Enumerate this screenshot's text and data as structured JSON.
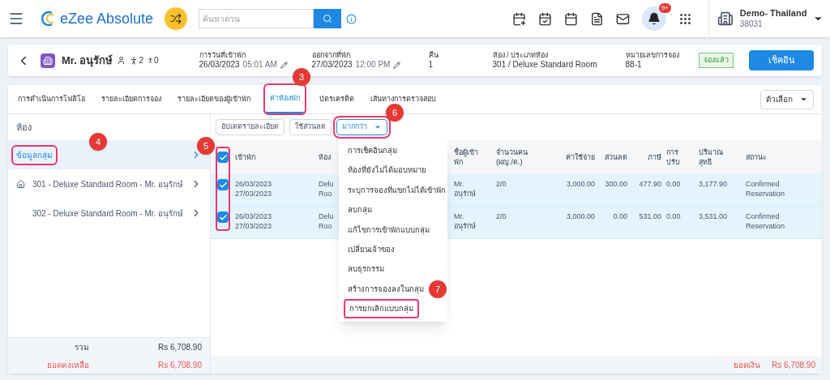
{
  "top_bar": {
    "brand": "eZee Absolute",
    "search": {
      "placeholder": "ค้นหาด่วน"
    },
    "notification_count": "9+",
    "property": {
      "name": "Demo- Thailand",
      "code": "38031"
    }
  },
  "booking_header": {
    "guest": "Mr. อนุรักษ์",
    "adults": "2",
    "children": "0",
    "fields": [
      {
        "label": "การวันที่เข้าพัก",
        "value": "26/03/2023",
        "time": "05:01 AM",
        "editable": true
      },
      {
        "label": "ออกจากที่พัก",
        "value": "27/03/2023",
        "time": "12:00 PM",
        "editable": true
      },
      {
        "label": "คืน",
        "value": "1",
        "editable": false
      },
      {
        "label": "ห้อง / ประเภทห้อง",
        "value": "301 / Deluxe Standard Room",
        "editable": false
      },
      {
        "label": "หมายเลขการจอง",
        "value": "88-1",
        "editable": false
      }
    ],
    "status": "จองแล้ว",
    "action": "เช็คอิน"
  },
  "tabs": [
    {
      "label": "การดำเนินการโฟลิโอ",
      "selected": false,
      "highlighted": false
    },
    {
      "label": "รายละเอียดการจอง",
      "selected": false,
      "highlighted": false
    },
    {
      "label": "รายละเอียดของผู้เข้าพัก",
      "selected": false,
      "highlighted": false
    },
    {
      "label": "ค่าห้องพัก",
      "selected": true,
      "highlighted": true
    },
    {
      "label": "บัตรเครดิต",
      "selected": false,
      "highlighted": false
    },
    {
      "label": "เส้นทางการตรวจสอบ",
      "selected": false,
      "highlighted": false
    }
  ],
  "options_button": "ตัวเลือก",
  "sidebar": {
    "title": "ห้อง",
    "items": [
      {
        "label": "ข้อมูลกลุ่ม",
        "kind": "group",
        "selected": true,
        "highlighted": true
      },
      {
        "label": "301 - Deluxe Standard Room - Mr. อนุรักษ์",
        "kind": "master",
        "selected": false,
        "highlighted": false
      },
      {
        "label": "302 - Deluxe Standard Room - Mr. อนุรักษ์",
        "kind": "room",
        "selected": false,
        "highlighted": false
      }
    ],
    "totals": [
      {
        "label": "รวม",
        "value": "Rs 6,708.90",
        "kind": "total"
      },
      {
        "label": "ยอดคงเหลือ",
        "value": "Rs 6,708.90",
        "kind": "balance"
      }
    ]
  },
  "toolbar": [
    {
      "label": "อัปเดตรายละเอียด",
      "kind": "button",
      "highlighted": false
    },
    {
      "label": "ใช้ส่วนลด",
      "kind": "button",
      "highlighted": false
    },
    {
      "label": "มากกว่า",
      "kind": "dropdown",
      "highlighted": true
    }
  ],
  "table": {
    "select_all_checked": true,
    "checkboxes_highlighted": true,
    "columns": [
      "เข้าพัก",
      "ห้อง",
      "ชื่อผู้เข้า\nพัก",
      "จำนวนคน\n(ผญ./ด.)",
      "ค่าใช้จ่าย",
      "ส่วนลด",
      "ภาษี",
      "การ\nปรับ",
      "ปริมาณ\nสุทธิ",
      "สถานะ"
    ],
    "rows": [
      {
        "checked": true,
        "cells": [
          "26/03/2023\n27/03/2023",
          "Delu\nRoo",
          "Mr.\nอนุรักษ์",
          "2/0",
          "3,000.00",
          "300.00",
          "477.90",
          "0.00",
          "3,177.90",
          "Confirmed\nReservation"
        ]
      },
      {
        "checked": true,
        "cells": [
          "26/03/2023\n27/03/2023",
          "Delu\nRoo",
          "Mr.\nอนุรักษ์",
          "2/0",
          "3,000.00",
          "0.00",
          "531.00",
          "0.00",
          "3,531.00",
          "Confirmed\nReservation"
        ]
      }
    ]
  },
  "dropdown_menu": {
    "items": [
      {
        "label": "การเช็คอินกลุ่ม",
        "highlighted": false
      },
      {
        "label": "ห้องที่ยังไม่ได้มอบหมาย",
        "highlighted": false
      },
      {
        "label": "ระบุการจองที่แขกไม่ได้เข้าพัก",
        "highlighted": false
      },
      {
        "label": "ลบกลุ่ม",
        "highlighted": false
      },
      {
        "label": "แก้ไขการเข้าพักแบบกลุ่ม",
        "highlighted": false
      },
      {
        "label": "เปลี่ยนเจ้าของ",
        "highlighted": false
      },
      {
        "label": "ลบธุรกรรม",
        "highlighted": false
      },
      {
        "label": "สร้างการจองลงในกลุ่ม",
        "highlighted": false
      },
      {
        "label": "การยกเลิกแบบกลุ่ม",
        "highlighted": true
      }
    ]
  },
  "footer": {
    "label": "ยอดเงิน",
    "value": "Rs 6,708.90"
  },
  "annotations": [
    "3",
    "4",
    "5",
    "6",
    "7"
  ]
}
